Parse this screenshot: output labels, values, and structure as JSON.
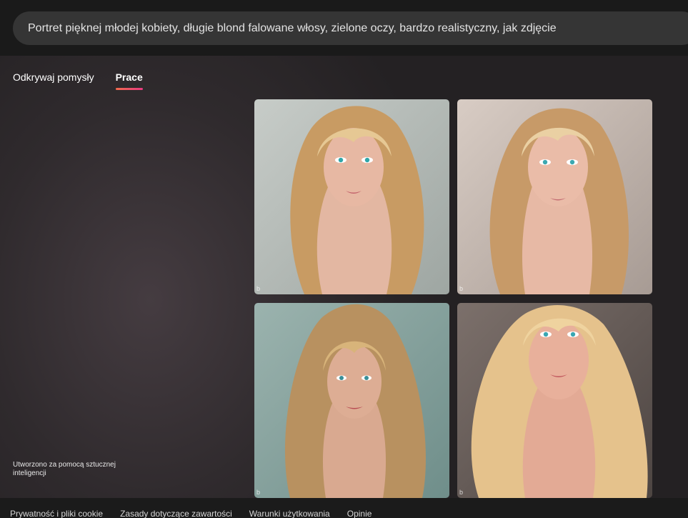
{
  "search": {
    "prompt": "Portret pięknej młodej kobiety, długie blond falowane włosy, zielone oczy, bardzo realistyczny, jak zdjęcie"
  },
  "tabs": [
    {
      "label": "Odkrywaj pomysły",
      "active": false
    },
    {
      "label": "Prace",
      "active": true
    }
  ],
  "images": [
    {
      "alt": "",
      "bg": "#b9c0bc",
      "hair": "#d8b27a",
      "skin": "#e6b49f"
    },
    {
      "alt": "",
      "bg": "#c9bdb4",
      "hair": "#e0c08c",
      "skin": "#e8b7a3"
    },
    {
      "alt": "",
      "bg": "#8fa8a4",
      "hair": "#c9a873",
      "skin": "#d9a990"
    },
    {
      "alt": "",
      "bg": "#6e6461",
      "hair": "#e8c892",
      "skin": "#e6ae99"
    }
  ],
  "ai_note": "Utworzono za pomocą sztucznej inteligencji",
  "footer": {
    "links": [
      "Prywatność i pliki cookie",
      "Zasady dotyczące zawartości",
      "Warunki użytkowania",
      "Opinie"
    ]
  },
  "colors": {
    "tab_underline_start": "#f26a4d",
    "tab_underline_end": "#e83a82"
  }
}
